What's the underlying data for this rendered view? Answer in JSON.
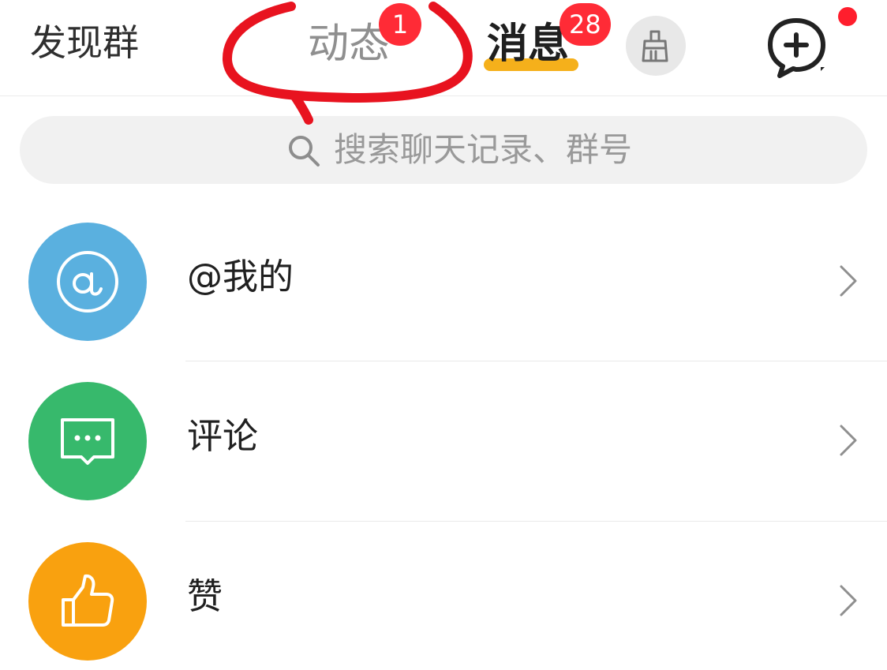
{
  "header": {
    "left_link": "发现群",
    "tabs": [
      {
        "label": "动态",
        "badge": "1",
        "active": false
      },
      {
        "label": "消息",
        "badge": "28",
        "active": true
      }
    ]
  },
  "colors": {
    "active_tab_underline": "#f5b01b",
    "badge_red": "#ff2b36",
    "mention_blue": "#5ab0df",
    "comment_green": "#37b96c",
    "like_orange": "#f9a10f",
    "annotation_red": "#e8131f"
  },
  "icons": {
    "clean": "broom-icon",
    "compose": "message-plus-icon",
    "search": "search-icon",
    "mention": "at-sign-icon",
    "comment": "comment-dots-icon",
    "like": "thumbs-up-icon",
    "chevron": "chevron-right-icon"
  },
  "search": {
    "placeholder": "搜索聊天记录、群号"
  },
  "list": [
    {
      "label": "@我的"
    },
    {
      "label": "评论"
    },
    {
      "label": "赞"
    }
  ]
}
